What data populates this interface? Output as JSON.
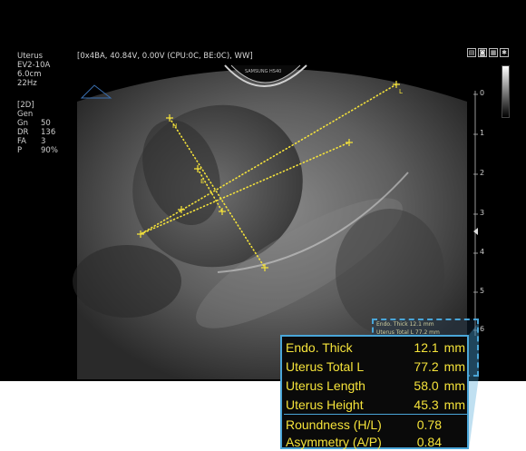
{
  "probe": {
    "name": "Uterus",
    "model": "EV2-10A",
    "depth": "6.0cm",
    "frame_rate": "22Hz"
  },
  "mode": {
    "label": "[2D]",
    "sub": "Gen",
    "params": [
      {
        "k": "Gn",
        "v": "50"
      },
      {
        "k": "DR",
        "v": "136"
      },
      {
        "k": "FA",
        "v": "3"
      },
      {
        "k": "P",
        "v": "90%"
      }
    ]
  },
  "header": {
    "status": "[0x4BA, 40.84V, 0.00V (CPU:0C, BE:0C), WW]"
  },
  "brand": "SAMSUNG HS40",
  "toolbar_icons": [
    "print-icon",
    "camera-icon",
    "doc-icon",
    "settings-icon"
  ],
  "depth_scale": {
    "labels": [
      "0",
      "1",
      "2",
      "3",
      "4",
      "5",
      "6"
    ]
  },
  "markers": {
    "h_label": "H",
    "e_label": "E",
    "l_label": "L"
  },
  "mini_table": {
    "rows": [
      "Endo. Thick   12.1 mm",
      "Uterus Total L   77.2 mm"
    ]
  },
  "results": {
    "rows": [
      {
        "label": "Endo. Thick",
        "value": "12.1",
        "unit": "mm"
      },
      {
        "label": "Uterus Total L",
        "value": "77.2",
        "unit": "mm"
      },
      {
        "label": "Uterus Length",
        "value": "58.0",
        "unit": "mm"
      },
      {
        "label": "Uterus Height",
        "value": "45.3",
        "unit": "mm"
      },
      {
        "label": "Roundness (H/L)",
        "value": "0.78",
        "unit": ""
      },
      {
        "label": "Asymmetry (A/P)",
        "value": "0.84",
        "unit": ""
      }
    ]
  },
  "colors": {
    "caliper": "#f5e33a",
    "panel_border": "#4aa6d8"
  }
}
